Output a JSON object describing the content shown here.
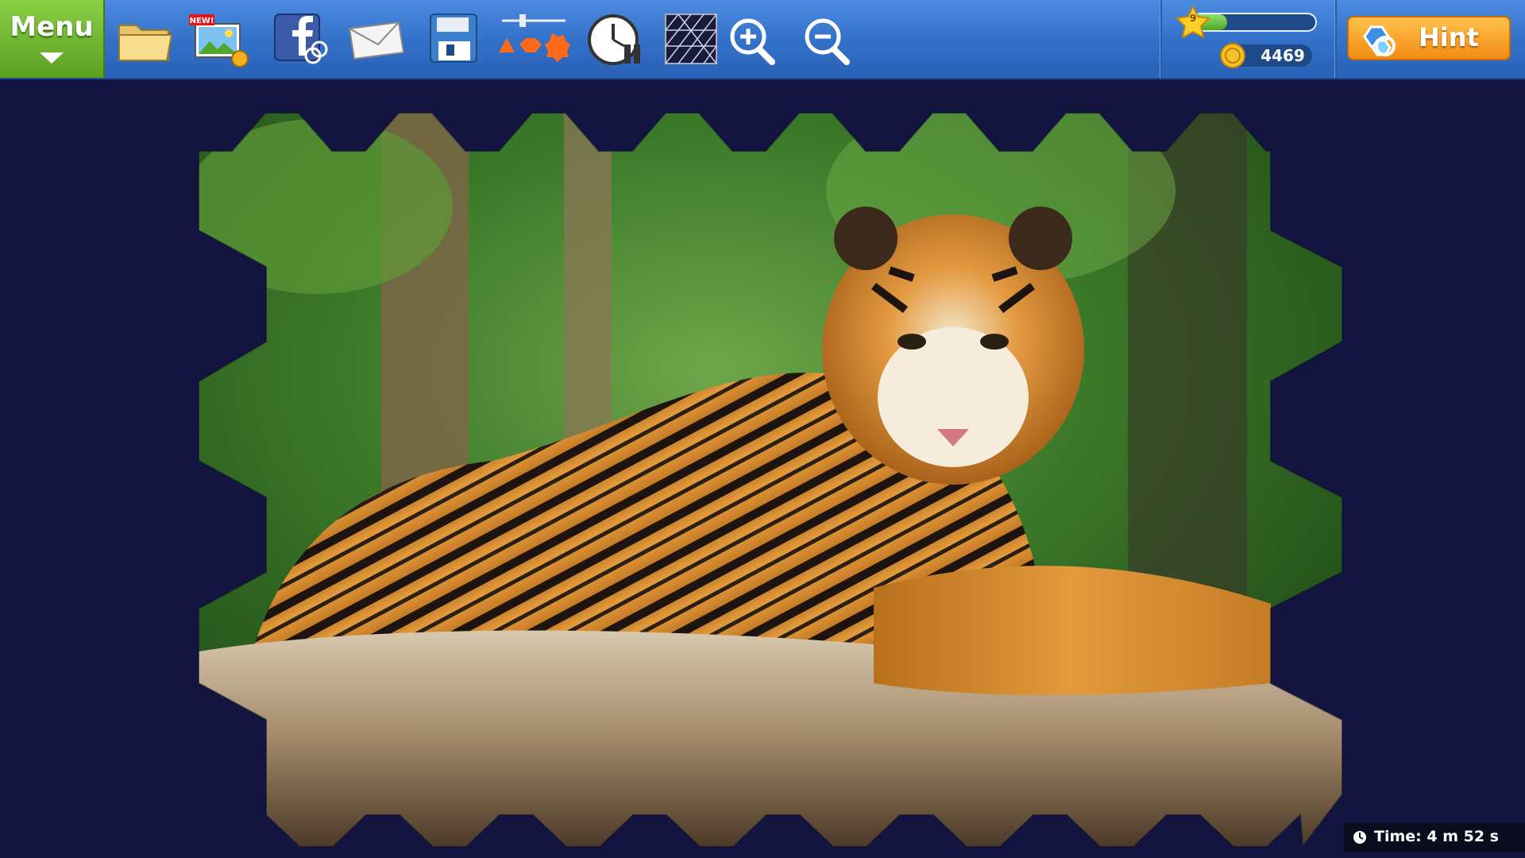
{
  "toolbar": {
    "menu_label": "Menu",
    "new_badge": "NEW!",
    "tools": [
      {
        "name": "open-folder-icon"
      },
      {
        "name": "new-picture-icon"
      },
      {
        "name": "facebook-share-icon"
      },
      {
        "name": "mail-icon"
      },
      {
        "name": "save-disk-icon"
      },
      {
        "name": "piece-shape-icon"
      },
      {
        "name": "timer-pause-icon"
      },
      {
        "name": "grid-icon"
      },
      {
        "name": "zoom-in-icon"
      },
      {
        "name": "zoom-out-icon"
      }
    ],
    "level": "9",
    "xp_fraction": 0.28,
    "coins": "4469",
    "hint_label": "Hint"
  },
  "status": {
    "timer": "Time: 4 m 52 s"
  },
  "colors": {
    "background": "#131540",
    "toolbar": "#3270c8",
    "menu": "#6aad2c",
    "hint": "#f5a226"
  }
}
